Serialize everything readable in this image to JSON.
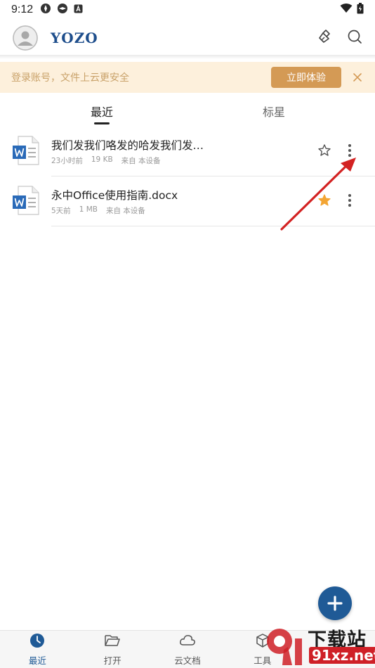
{
  "status_bar": {
    "time": "9:12"
  },
  "app_bar": {
    "logo_text": "YOZO"
  },
  "banner": {
    "text": "登录账号，文件上云更安全",
    "cta_label": "立即体验"
  },
  "tabs": [
    {
      "label": "最近",
      "active": true
    },
    {
      "label": "标星",
      "active": false
    }
  ],
  "files": [
    {
      "name": "我们发我们咯发的哈发我们发…",
      "time": "23小时前",
      "size": "19 KB",
      "source": "来自 本设备",
      "starred": false
    },
    {
      "name": "永中Office使用指南.docx",
      "time": "5天前",
      "size": "1 MB",
      "source": "来自 本设备",
      "starred": true
    }
  ],
  "bottom_nav": [
    {
      "label": "最近",
      "icon": "clock-icon",
      "active": true
    },
    {
      "label": "打开",
      "icon": "folder-open-icon",
      "active": false
    },
    {
      "label": "云文档",
      "icon": "cloud-icon",
      "active": false
    },
    {
      "label": "工具",
      "icon": "cube-icon",
      "active": false
    },
    {
      "label": "",
      "icon": "user-icon",
      "active": false
    }
  ],
  "watermark": {
    "title": "下载站",
    "url": "91xz.net"
  },
  "colors": {
    "brand": "#1f5a96",
    "banner_bg": "#fdf0dc",
    "banner_cta": "#d49a55",
    "star_active": "#f3a533",
    "annotation_arrow": "#d32222"
  }
}
